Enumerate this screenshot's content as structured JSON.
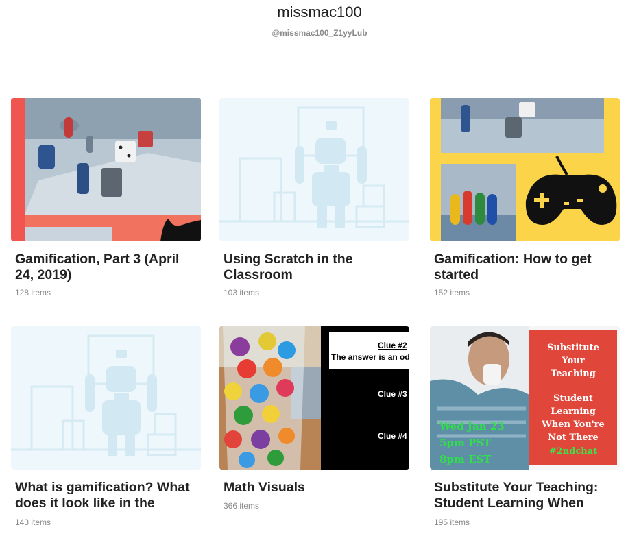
{
  "profile": {
    "name": "missmac100",
    "handle": "@missmac100_Z1yyLub"
  },
  "collections": [
    {
      "title": "Gamification, Part 3 (April 24, 2019)",
      "count": "128 items",
      "thumb": "board-game-photo"
    },
    {
      "title": "Using Scratch in the Classroom",
      "count": "103 items",
      "thumb": "robot-placeholder"
    },
    {
      "title": "Gamification: How to get started",
      "count": "152 items",
      "thumb": "game-collage"
    },
    {
      "title": "What is gamification? What does it look like in the",
      "count": "143 items",
      "thumb": "robot-placeholder"
    },
    {
      "title": "Math Visuals",
      "count": "366 items",
      "thumb": "math-clues",
      "thumb_text": {
        "clue2": "Clue #2",
        "answer": "The answer is an od",
        "clue3": "Clue #3",
        "clue4": "Clue #4"
      }
    },
    {
      "title": "Substitute Your Teaching: Student Learning When",
      "count": "195 items",
      "thumb": "substitute-chat",
      "thumb_text": {
        "line1": "Substitute",
        "line2": "Your",
        "line3": "Teaching",
        "line4": "Student",
        "line5": "Learning",
        "line6": "When You're",
        "line7": "Not There",
        "hashtag": "#2ndchat",
        "date1": "Wed Jan 23",
        "date2": "5pm PST",
        "date3": "8pm EST"
      }
    }
  ],
  "colors": {
    "coral": "#f0554f",
    "yellow": "#fbd44a",
    "placeholder_bg": "#eef7fb",
    "placeholder_fg": "#d2e8f2"
  }
}
